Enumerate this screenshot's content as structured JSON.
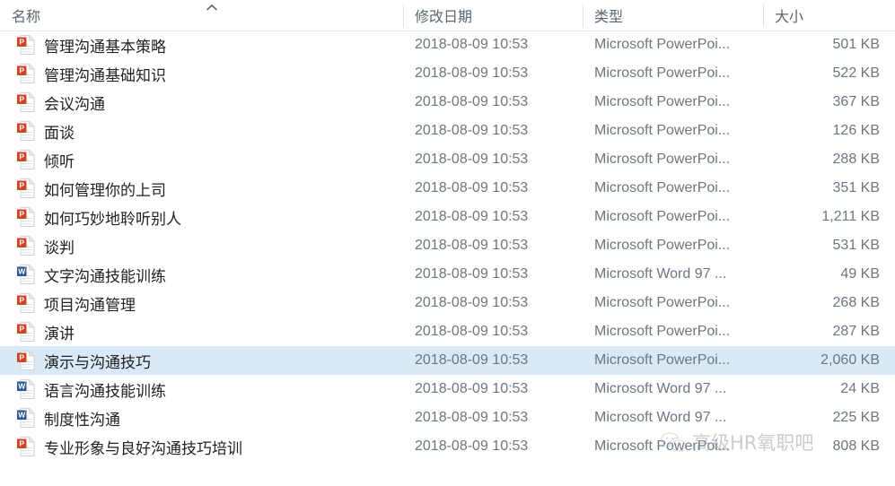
{
  "header": {
    "columns": [
      {
        "label": "名称",
        "sort_indicator": "chevron-up-icon"
      },
      {
        "label": "修改日期"
      },
      {
        "label": "类型"
      },
      {
        "label": "大小"
      }
    ]
  },
  "files": [
    {
      "name": "管理沟通基本策略",
      "date": "2018-08-09 10:53",
      "type": "Microsoft PowerPoi...",
      "size": "501 KB",
      "icon": "powerpoint-file-icon",
      "selected": false
    },
    {
      "name": "管理沟通基础知识",
      "date": "2018-08-09 10:53",
      "type": "Microsoft PowerPoi...",
      "size": "522 KB",
      "icon": "powerpoint-file-icon",
      "selected": false
    },
    {
      "name": "会议沟通",
      "date": "2018-08-09 10:53",
      "type": "Microsoft PowerPoi...",
      "size": "367 KB",
      "icon": "powerpoint-file-icon",
      "selected": false
    },
    {
      "name": "面谈",
      "date": "2018-08-09 10:53",
      "type": "Microsoft PowerPoi...",
      "size": "126 KB",
      "icon": "powerpoint-file-icon",
      "selected": false
    },
    {
      "name": "倾听",
      "date": "2018-08-09 10:53",
      "type": "Microsoft PowerPoi...",
      "size": "288 KB",
      "icon": "powerpoint-file-icon",
      "selected": false
    },
    {
      "name": "如何管理你的上司",
      "date": "2018-08-09 10:53",
      "type": "Microsoft PowerPoi...",
      "size": "351 KB",
      "icon": "powerpoint-file-icon",
      "selected": false
    },
    {
      "name": "如何巧妙地聆听别人",
      "date": "2018-08-09 10:53",
      "type": "Microsoft PowerPoi...",
      "size": "1,211 KB",
      "icon": "powerpoint-file-icon",
      "selected": false
    },
    {
      "name": "谈判",
      "date": "2018-08-09 10:53",
      "type": "Microsoft PowerPoi...",
      "size": "531 KB",
      "icon": "powerpoint-file-icon",
      "selected": false
    },
    {
      "name": "文字沟通技能训练",
      "date": "2018-08-09 10:53",
      "type": "Microsoft Word 97 ...",
      "size": "49 KB",
      "icon": "word-file-icon",
      "selected": false
    },
    {
      "name": "项目沟通管理",
      "date": "2018-08-09 10:53",
      "type": "Microsoft PowerPoi...",
      "size": "268 KB",
      "icon": "powerpoint-file-icon",
      "selected": false
    },
    {
      "name": "演讲",
      "date": "2018-08-09 10:53",
      "type": "Microsoft PowerPoi...",
      "size": "287 KB",
      "icon": "powerpoint-file-icon",
      "selected": false
    },
    {
      "name": "演示与沟通技巧",
      "date": "2018-08-09 10:53",
      "type": "Microsoft PowerPoi...",
      "size": "2,060 KB",
      "icon": "powerpoint-file-icon",
      "selected": true
    },
    {
      "name": "语言沟通技能训练",
      "date": "2018-08-09 10:53",
      "type": "Microsoft Word 97 ...",
      "size": "24 KB",
      "icon": "word-file-icon",
      "selected": false
    },
    {
      "name": "制度性沟通",
      "date": "2018-08-09 10:53",
      "type": "Microsoft Word 97 ...",
      "size": "225 KB",
      "icon": "word-file-icon",
      "selected": false
    },
    {
      "name": "专业形象与良好沟通技巧培训",
      "date": "2018-08-09 10:53",
      "type": "Microsoft PowerPoi...",
      "size": "808 KB",
      "icon": "powerpoint-file-icon",
      "selected": false
    }
  ],
  "watermark": {
    "text": "高级HR氧职吧",
    "logo": "wechat-logo-icon"
  },
  "colors": {
    "powerpoint": "#d14524",
    "word": "#2b579a",
    "selection": "#d9e9f7",
    "header_text": "#5a6673",
    "cell_text": "#6b7683",
    "name_text": "#222222"
  }
}
